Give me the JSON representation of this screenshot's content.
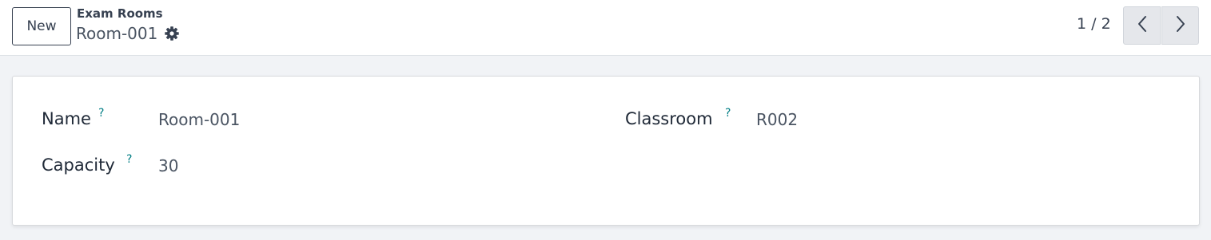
{
  "control_panel": {
    "new_button_label": "New",
    "breadcrumb": "Exam Rooms",
    "record_name": "Room-001",
    "pager": {
      "value": "1 / 2"
    },
    "icons": {
      "gear": "gear-icon",
      "prev": "chevron-left-icon",
      "next": "chevron-right-icon"
    }
  },
  "form": {
    "help_marker": "?",
    "fields": {
      "name": {
        "label": "Name",
        "value": "Room-001"
      },
      "classroom": {
        "label": "Classroom",
        "value": "R002"
      },
      "capacity": {
        "label": "Capacity",
        "value": "30"
      }
    }
  },
  "colors": {
    "background": "#f1f3f6",
    "help_accent": "#017e84",
    "text": "#374151"
  }
}
